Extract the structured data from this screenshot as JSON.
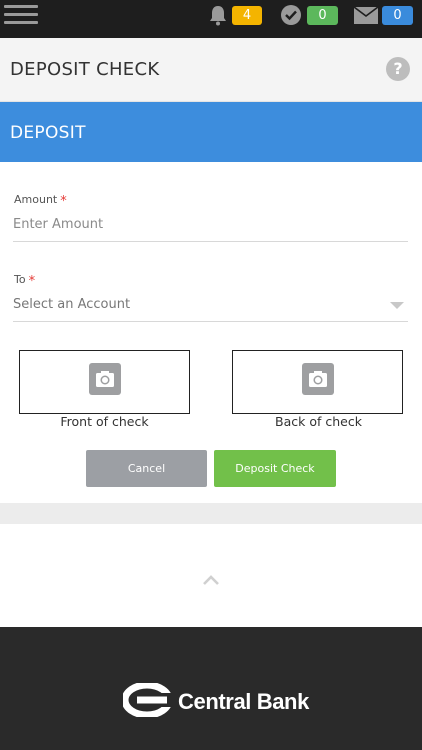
{
  "status_bar": {
    "notifications": {
      "icon": "bell-icon",
      "count": "4",
      "color": "#f4b400"
    },
    "approvals": {
      "icon": "checkmark-circle-icon",
      "count": "0",
      "color": "#5cb85c"
    },
    "messages": {
      "icon": "envelope-icon",
      "count": "0",
      "color": "#3a8bdc"
    }
  },
  "header": {
    "title": "DEPOSIT CHECK",
    "help_icon": "?"
  },
  "section": {
    "title": "DEPOSIT",
    "color": "#3d8ddd"
  },
  "form": {
    "amount": {
      "label": "Amount",
      "required_mark": "*",
      "placeholder": "Enter Amount",
      "value": ""
    },
    "to": {
      "label": "To",
      "required_mark": "*",
      "placeholder": "Select an Account"
    }
  },
  "check_images": {
    "front": {
      "label": "Front of check",
      "icon": "camera-icon"
    },
    "back": {
      "label": "Back of check",
      "icon": "camera-icon"
    }
  },
  "buttons": {
    "cancel": "Cancel",
    "deposit": "Deposit Check"
  },
  "footer": {
    "brand": "Central Bank",
    "logo_icon": "central-bank-logo"
  }
}
